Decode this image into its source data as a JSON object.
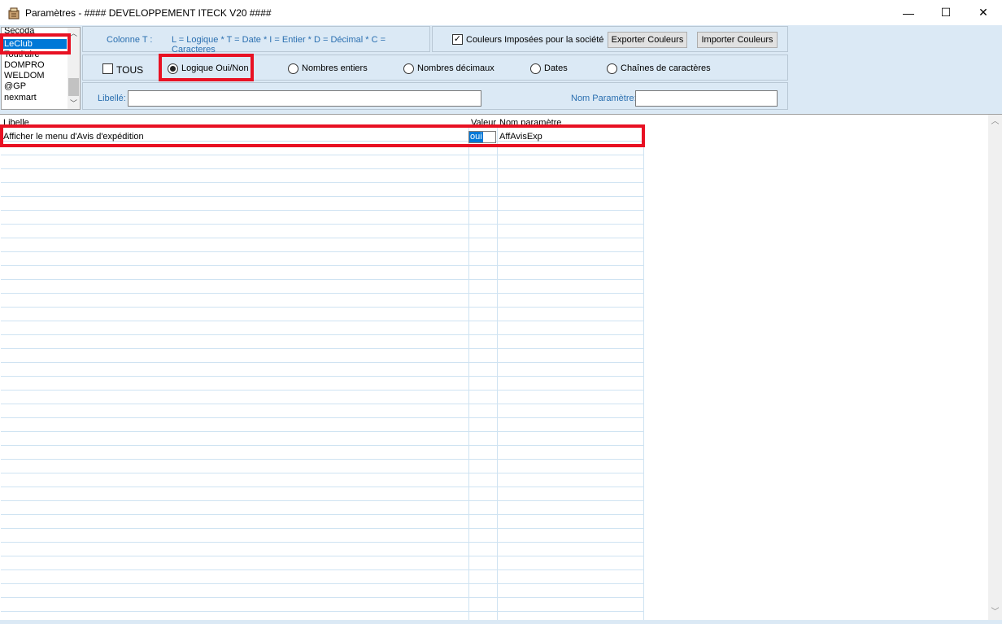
{
  "window": {
    "title": "Paramètres - #### DEVELOPPEMENT ITECK V20 ####",
    "minimize_glyph": "—",
    "maximize_glyph": "☐",
    "close_glyph": "✕"
  },
  "companies": {
    "items": [
      "Secoda",
      "LeClub",
      "Toutl'aire",
      "DOMPRO",
      "WELDOM",
      "@GP",
      "nexmart"
    ],
    "selected": "LeClub"
  },
  "legend": {
    "label": "Colonne T :",
    "text": "L = Logique * T = Date * I = Entier * D = Décimal * C = Caracteres"
  },
  "colors": {
    "checkbox_label": "Couleurs Imposées pour la société",
    "checked": true,
    "export_label": "Exporter Couleurs",
    "import_label": "Importer Couleurs"
  },
  "types": {
    "all_label": "TOUS",
    "options": [
      "Logique Oui/Non",
      "Nombres entiers",
      "Nombres décimaux",
      "Dates",
      "Chaînes de caractères"
    ],
    "selected": "Logique Oui/Non"
  },
  "filters": {
    "libelle_label": "Libellé:",
    "libelle_value": "",
    "nom_label": "Nom Paramètre:",
    "nom_value": ""
  },
  "grid": {
    "headers": {
      "libelle": "Libelle",
      "valeur": "Valeur",
      "nom": "Nom paramètre"
    },
    "rows": [
      {
        "libelle": "Afficher le menu d'Avis d'expédition",
        "valeur": "oui",
        "nom": "AffAvisExp"
      }
    ]
  },
  "accent": "#0078d7",
  "highlight_color": "#e81123"
}
